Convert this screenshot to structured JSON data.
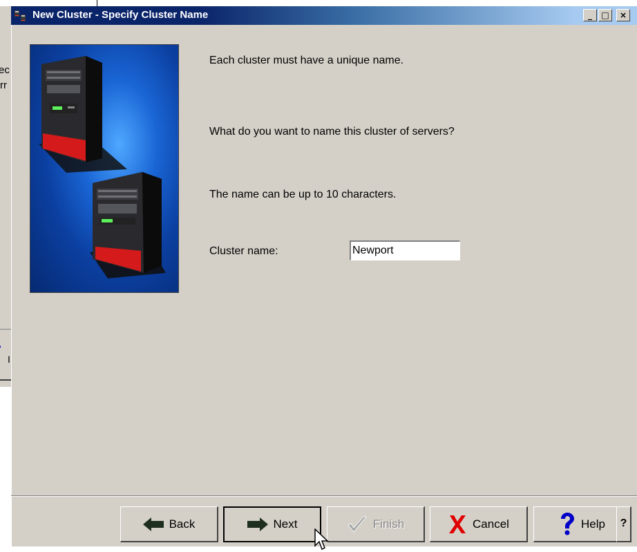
{
  "background_window": {
    "fragments": [
      "ec",
      "rr",
      "'",
      "I"
    ]
  },
  "dialog": {
    "title": "New Cluster - Specify Cluster Name",
    "titlebar_buttons": {
      "minimize": "_",
      "maximize": "□",
      "close": "×"
    },
    "image_icon": "servers-illustration",
    "intro_text": "Each cluster must have a unique name.",
    "question_text": "What do you want to name this cluster of servers?",
    "hint_text": "The name can be up to 10 characters.",
    "cluster_name": {
      "label": "Cluster name:",
      "value": "Newport"
    },
    "buttons": {
      "back": "Back",
      "next": "Next",
      "finish": "Finish",
      "cancel": "Cancel",
      "help": "Help",
      "context_help": "?"
    },
    "icons": {
      "back": "left-arrow-icon",
      "next": "right-arrow-icon",
      "finish": "checkmark-icon",
      "cancel": "red-x-icon",
      "help": "question-mark-icon"
    },
    "colors": {
      "titlebar_start": "#0a246a",
      "titlebar_end": "#a6caf0",
      "dialog_bg": "#d4d0c8",
      "cancel_icon": "#e00000",
      "help_icon": "#0000c8"
    }
  }
}
